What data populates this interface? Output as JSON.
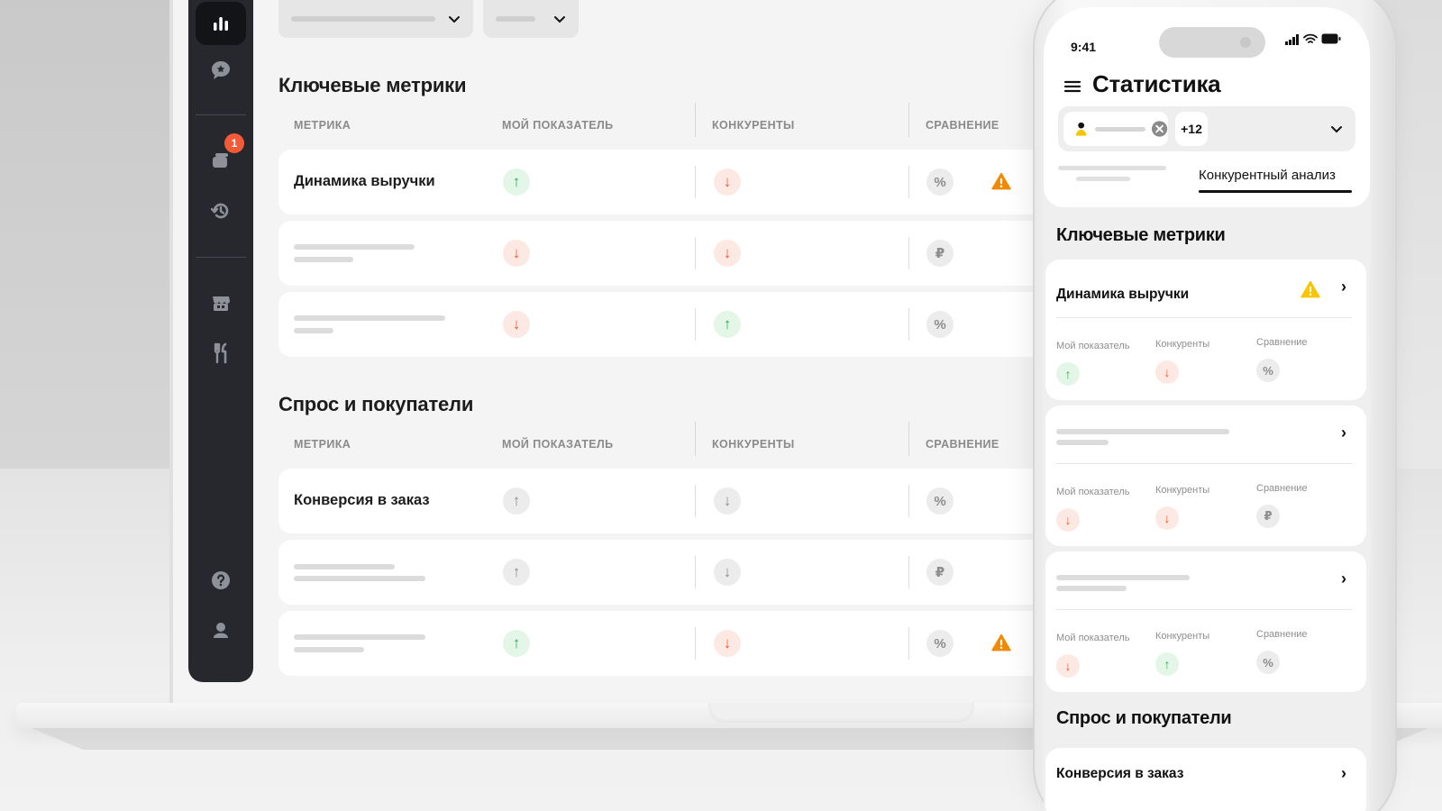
{
  "sections": [
    {
      "title": "Ключевые метрики",
      "columns": [
        "МЕТРИКА",
        "МОЙ ПОКАЗАТЕЛЬ",
        "КОНКУРЕНТЫ",
        "СРАВНЕНИЕ"
      ],
      "rows": [
        {
          "label": "Динамика выручки",
          "mine": "up",
          "competitors": "down",
          "compare": "%",
          "warning": true
        },
        {
          "label": "",
          "mine": "down",
          "competitors": "down",
          "compare": "₽",
          "warning": false
        },
        {
          "label": "",
          "mine": "down",
          "competitors": "up",
          "compare": "%",
          "warning": false
        }
      ]
    },
    {
      "title": "Спрос и покупатели",
      "columns": [
        "МЕТРИКА",
        "МОЙ ПОКАЗАТЕЛЬ",
        "КОНКУРЕНТЫ",
        "СРАВНЕНИЕ"
      ],
      "rows": [
        {
          "label": "Конверсия в заказ",
          "mine": "neutral-up",
          "competitors": "neutral-down",
          "compare": "%",
          "warning": false
        },
        {
          "label": "",
          "mine": "neutral-up",
          "competitors": "neutral-down",
          "compare": "₽",
          "warning": false
        },
        {
          "label": "",
          "mine": "up",
          "competitors": "down",
          "compare": "%",
          "warning": true
        }
      ]
    }
  ],
  "sidebar": {
    "items": [
      {
        "icon": "bar-chart-icon",
        "active": true
      },
      {
        "icon": "reviews-icon",
        "active": false
      },
      {
        "icon": "orders-icon",
        "active": false,
        "badge": "1"
      },
      {
        "icon": "history-icon",
        "active": false
      },
      {
        "icon": "store-icon",
        "active": false
      },
      {
        "icon": "restaurant-icon",
        "active": false
      },
      {
        "icon": "help-icon",
        "active": false
      },
      {
        "icon": "profile-icon",
        "active": false
      }
    ]
  },
  "icons": {
    "up": "↑",
    "down": "↓"
  },
  "colors": {
    "up": "#22b14c",
    "down": "#f0572d",
    "warning": "#f08a00",
    "sidebar": "#26282d"
  },
  "phone": {
    "time": "9:41",
    "title": "Статистика",
    "filter_more": "+12",
    "active_tab": "Конкурентный анализ",
    "section_key": "Ключевые метрики",
    "section_demand": "Спрос и покупатели",
    "col_mine": "Мой показатель",
    "col_competitors": "Конкуренты",
    "col_compare": "Сравнение",
    "cards": [
      {
        "title": "Динамика выручки",
        "mine": "up",
        "competitors": "down",
        "compare": "%",
        "warning": true
      },
      {
        "title": "",
        "mine": "down",
        "competitors": "down",
        "compare": "₽",
        "warning": false
      },
      {
        "title": "",
        "mine": "down",
        "competitors": "up",
        "compare": "%",
        "warning": false
      }
    ],
    "demand_card_title": "Конверсия в заказ"
  }
}
